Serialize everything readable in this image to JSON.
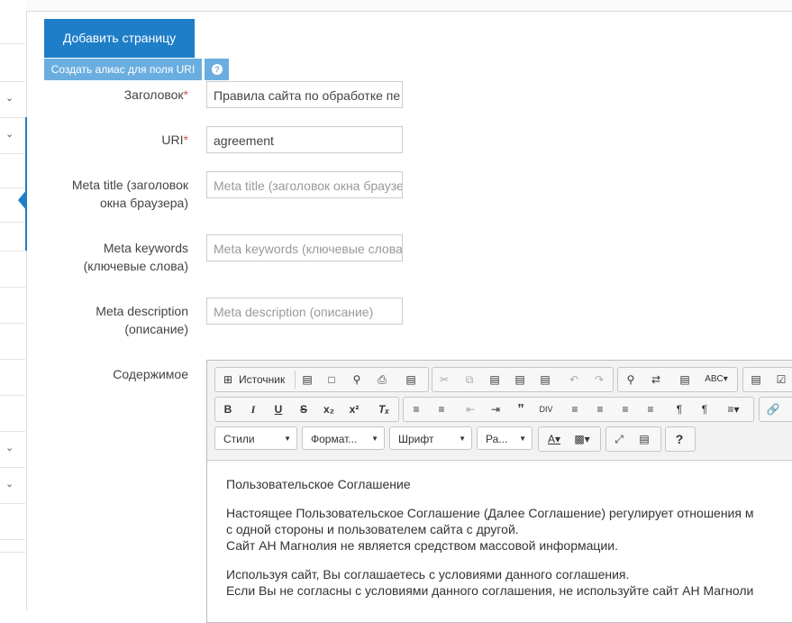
{
  "tabs": {
    "add_page": "Добавить страницу"
  },
  "alias_button": "Создать алиас для поля URI",
  "help_icon": "?",
  "form": {
    "title": {
      "label": "Заголовок",
      "required_mark": "*",
      "value": "Правила сайта по обработке пе"
    },
    "uri": {
      "label": "URI",
      "required_mark": "*",
      "value": "agreement"
    },
    "meta_title": {
      "label_line1": "Meta title (заголовок",
      "label_line2": "окна браузера)",
      "placeholder": "Meta title (заголовок окна браузе"
    },
    "meta_keywords": {
      "label_line1": "Meta keywords",
      "label_line2": "(ключевые слова)",
      "placeholder": "Meta keywords (ключевые слова"
    },
    "meta_description": {
      "label_line1": "Meta description",
      "label_line2": "(описание)",
      "placeholder": "Meta description (описание)"
    },
    "content": {
      "label": "Содержимое"
    }
  },
  "editor": {
    "source_label": "Источник",
    "styles_combo": "Стили",
    "format_combo": "Формат...",
    "font_combo": "Шрифт",
    "size_combo": "Ра...",
    "body": {
      "heading": "Пользовательское Соглашение",
      "p1_line1": "Настоящее Пользовательское Соглашение (Далее Соглашение) регулирует отношения м",
      "p1_line2": "с одной стороны и пользователем сайта с другой.",
      "p1_line3": "Сайт АН Магнолия не является средством массовой информации.",
      "p2_line1": "Используя сайт, Вы соглашаетесь с условиями данного соглашения.",
      "p2_line2": "Если Вы не согласны с условиями данного соглашения, не используйте сайт АН Магноли"
    }
  },
  "colors": {
    "primary": "#1e7ec8",
    "secondary": "#6aaee0",
    "required": "#d9534f"
  }
}
